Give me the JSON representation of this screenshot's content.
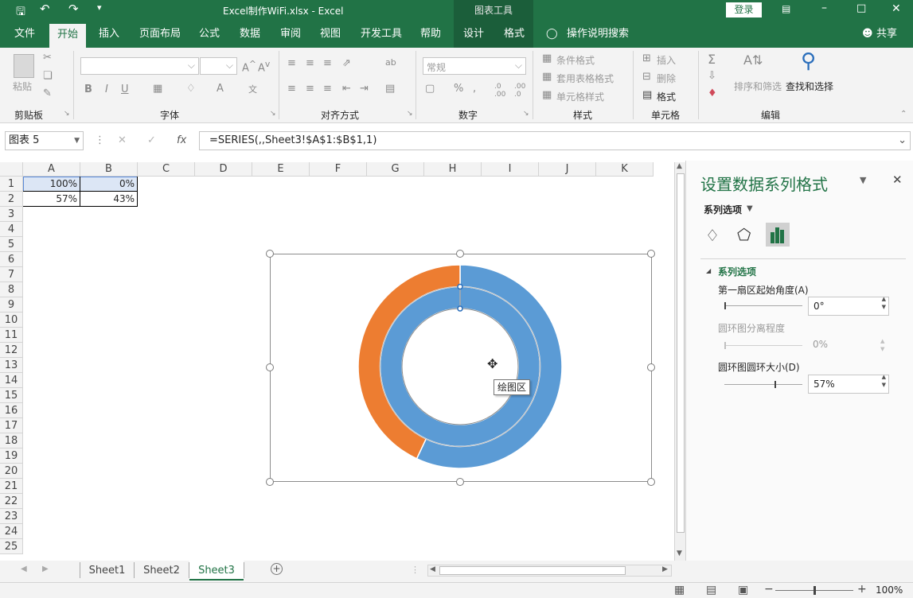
{
  "colors": {
    "excel_green": "#217346",
    "series_blue": "#5B9BD5",
    "series_orange": "#ED7D31"
  },
  "titlebar": {
    "filename": "Excel制作WiFi.xlsx  -  Excel",
    "context_tab_group": "图表工具",
    "login_button": "登录",
    "icons": [
      "save-icon",
      "undo-icon",
      "redo-icon",
      "customize-icon",
      "ribbon-display-icon",
      "minimize-icon",
      "maximize-icon",
      "close-icon"
    ]
  },
  "tabs": {
    "file": "文件",
    "home": "开始",
    "insert": "插入",
    "page_layout": "页面布局",
    "formulas": "公式",
    "data": "数据",
    "review": "审阅",
    "view": "视图",
    "developer": "开发工具",
    "help": "帮助",
    "design": "设计",
    "format": "格式",
    "tell_me": "操作说明搜索",
    "share": "共享"
  },
  "ribbon": {
    "clipboard": {
      "paste": "粘贴",
      "label": "剪贴板"
    },
    "font": {
      "label": "字体",
      "bold": "B",
      "italic": "I",
      "underline": "U"
    },
    "alignment": {
      "label": "对齐方式"
    },
    "number": {
      "format": "常规",
      "label": "数字",
      "percent": "%"
    },
    "styles": {
      "conditional": "条件格式",
      "table": "套用表格格式",
      "cell_styles": "单元格样式",
      "label": "样式"
    },
    "cells": {
      "insert": "插入",
      "delete": "删除",
      "format": "格式",
      "label": "单元格"
    },
    "editing": {
      "sort_filter": "排序和筛选",
      "find_select": "查找和选择",
      "label": "编辑"
    }
  },
  "formula_bar": {
    "name_box": "图表 5",
    "fx": "fx",
    "formula": "=SERIES(,,Sheet3!$A$1:$B$1,1)"
  },
  "columns": [
    "A",
    "B",
    "C",
    "D",
    "E",
    "F",
    "G",
    "H",
    "I",
    "J",
    "K"
  ],
  "rows": [
    "1",
    "2",
    "3",
    "4",
    "5",
    "6",
    "7",
    "8",
    "9",
    "10",
    "11",
    "12",
    "13",
    "14",
    "15",
    "16",
    "17",
    "18",
    "19",
    "20",
    "21",
    "22",
    "23",
    "24",
    "25"
  ],
  "cells": {
    "a1": "100%",
    "b1": "0%",
    "a2": "57%",
    "b2": "43%"
  },
  "chart_tooltip": "绘图区",
  "chart_data": {
    "type": "doughnut",
    "rings": [
      {
        "name": "",
        "values": [
          100,
          0
        ]
      },
      {
        "name": "",
        "values": [
          57,
          43
        ]
      }
    ],
    "colors": [
      "#5B9BD5",
      "#ED7D31"
    ],
    "first_slice_angle": 0,
    "hole_size_percent": 57
  },
  "panel": {
    "title": "设置数据系列格式",
    "series_options_dropdown": "系列选项",
    "section": "系列选项",
    "angle_label": "第一扇区起始角度(A)",
    "angle_value": "0°",
    "explosion_label": "圆环图分离程度",
    "explosion_value": "0%",
    "hole_label": "圆环图圆环大小(D)",
    "hole_value": "57%"
  },
  "sheets": {
    "s1": "Sheet1",
    "s2": "Sheet2",
    "s3": "Sheet3"
  },
  "status": {
    "zoom": "100%"
  }
}
